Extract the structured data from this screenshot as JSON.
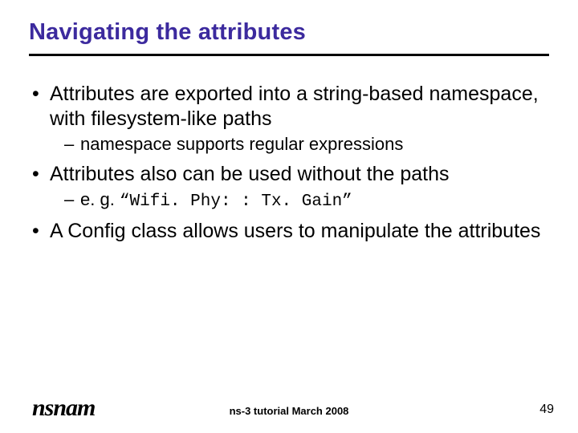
{
  "title": "Navigating the attributes",
  "bullets": {
    "b1": "Attributes are exported into a string-based namespace, with filesystem-like paths",
    "b1_sub": "namespace supports regular expressions",
    "b2": "Attributes also can be used without the paths",
    "b2_sub_prefix": "e. g. ",
    "b2_sub_code": "“Wifi. Phy: : Tx. Gain”",
    "b3": "A Config class allows users to manipulate the attributes"
  },
  "footer": {
    "logo": "nsnam",
    "center": "ns-3 tutorial March 2008",
    "page": "49"
  }
}
